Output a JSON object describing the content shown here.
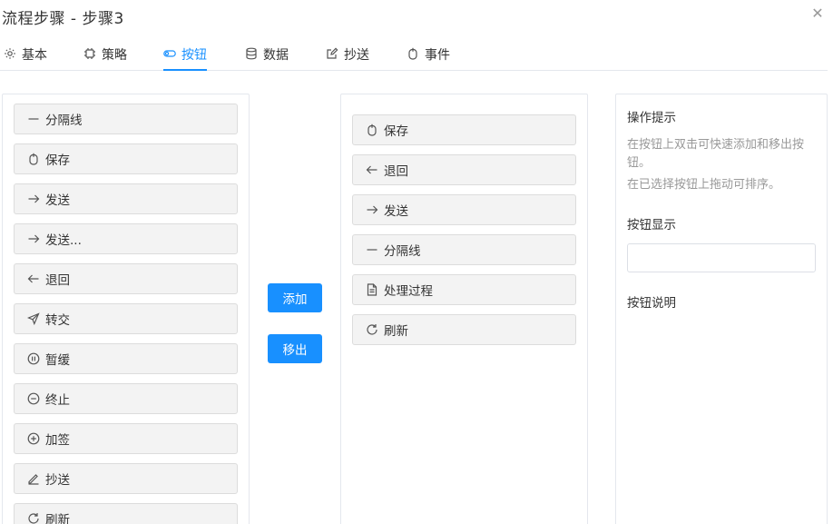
{
  "dialog": {
    "title": "流程步骤 - 步骤3"
  },
  "tabs": [
    {
      "label": "基本",
      "icon": "gear-icon"
    },
    {
      "label": "策略",
      "icon": "chip-icon"
    },
    {
      "label": "按钮",
      "icon": "toggle-icon",
      "active": true
    },
    {
      "label": "数据",
      "icon": "database-icon"
    },
    {
      "label": "抄送",
      "icon": "edit-icon"
    },
    {
      "label": "事件",
      "icon": "mouse-icon"
    }
  ],
  "available_buttons": [
    {
      "label": "分隔线",
      "icon": "minus-icon"
    },
    {
      "label": "保存",
      "icon": "mouse-icon"
    },
    {
      "label": "发送",
      "icon": "arrow-right-icon"
    },
    {
      "label": "发送...",
      "icon": "arrow-right-icon"
    },
    {
      "label": "退回",
      "icon": "arrow-left-icon"
    },
    {
      "label": "转交",
      "icon": "send-icon"
    },
    {
      "label": "暂缓",
      "icon": "pause-circle-icon"
    },
    {
      "label": "终止",
      "icon": "minus-circle-icon"
    },
    {
      "label": "加签",
      "icon": "plus-circle-icon"
    },
    {
      "label": "抄送",
      "icon": "pen-icon"
    },
    {
      "label": "刷新",
      "icon": "refresh-icon"
    }
  ],
  "actions": {
    "add_label": "添加",
    "remove_label": "移出"
  },
  "selected_buttons": [
    {
      "label": "保存",
      "icon": "mouse-icon"
    },
    {
      "label": "退回",
      "icon": "arrow-left-icon"
    },
    {
      "label": "发送",
      "icon": "arrow-right-icon"
    },
    {
      "label": "分隔线",
      "icon": "minus-icon"
    },
    {
      "label": "处理过程",
      "icon": "document-icon"
    },
    {
      "label": "刷新",
      "icon": "refresh-icon"
    }
  ],
  "tips": {
    "heading": "操作提示",
    "line1": "在按钮上双击可快速添加和移出按钮。",
    "line2": "在已选择按钮上拖动可排序。",
    "display_label": "按钮显示",
    "display_value": "",
    "note_label": "按钮说明"
  },
  "colors": {
    "accent": "#1890ff",
    "button_bg": "#f3f3f3",
    "border": "#dcdcdc"
  }
}
